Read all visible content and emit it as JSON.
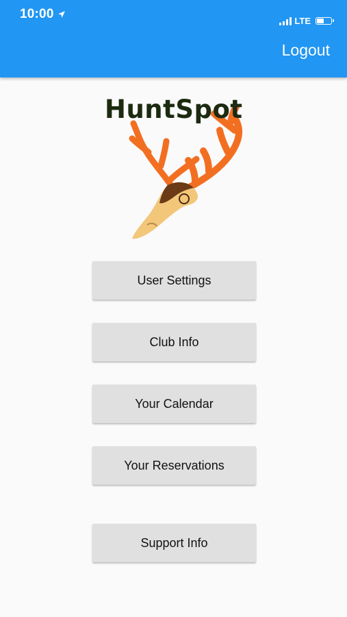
{
  "status_bar": {
    "time": "10:00",
    "network": "LTE",
    "battery_level": 0.55
  },
  "app_bar": {
    "logout_label": "Logout",
    "color": "#2196f3"
  },
  "logo": {
    "text": "HuntSpot",
    "antler_color": "#f26f22",
    "skull_color": "#f2c77a"
  },
  "menu": {
    "buttons": [
      {
        "label": "User Settings"
      },
      {
        "label": "Club Info"
      },
      {
        "label": "Your Calendar"
      },
      {
        "label": "Your Reservations"
      },
      {
        "label": "Support Info"
      }
    ]
  }
}
